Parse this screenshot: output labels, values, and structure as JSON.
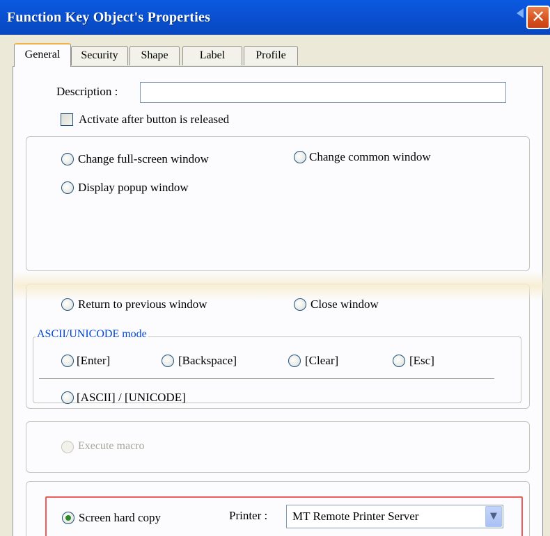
{
  "window": {
    "title": "Function Key Object's Properties",
    "close_glyph": "✕"
  },
  "tabs": [
    {
      "label": "General",
      "active": true
    },
    {
      "label": "Security",
      "active": false
    },
    {
      "label": "Shape",
      "active": false
    },
    {
      "label": "Label",
      "active": false
    },
    {
      "label": "Profile",
      "active": false
    }
  ],
  "description": {
    "label": "Description :",
    "value": ""
  },
  "activate_after_release": {
    "label": "Activate after button is released",
    "checked": false
  },
  "window_options": {
    "change_full_screen": "Change full-screen window",
    "change_common": "Change common window",
    "display_popup": "Display popup window"
  },
  "window_actions": {
    "return_previous": "Return to previous window",
    "close_window": "Close window"
  },
  "ascii_mode": {
    "legend": "ASCII/UNICODE mode",
    "enter": "[Enter]",
    "backspace": "[Backspace]",
    "clear": "[Clear]",
    "esc": "[Esc]",
    "ascii_unicode": "[ASCII] / [UNICODE]"
  },
  "macro": {
    "label": "Execute macro",
    "enabled": false
  },
  "hard_copy": {
    "label": "Screen hard copy",
    "selected": true,
    "printer_label": "Printer :",
    "printer_value": "MT Remote Printer Server",
    "dropdown_glyph": "▼"
  },
  "colors": {
    "titlebar": "#0a50d2",
    "dialog_bg": "#ece9d8",
    "highlight": "#ef5b5b",
    "legend_text": "#0046d5"
  }
}
